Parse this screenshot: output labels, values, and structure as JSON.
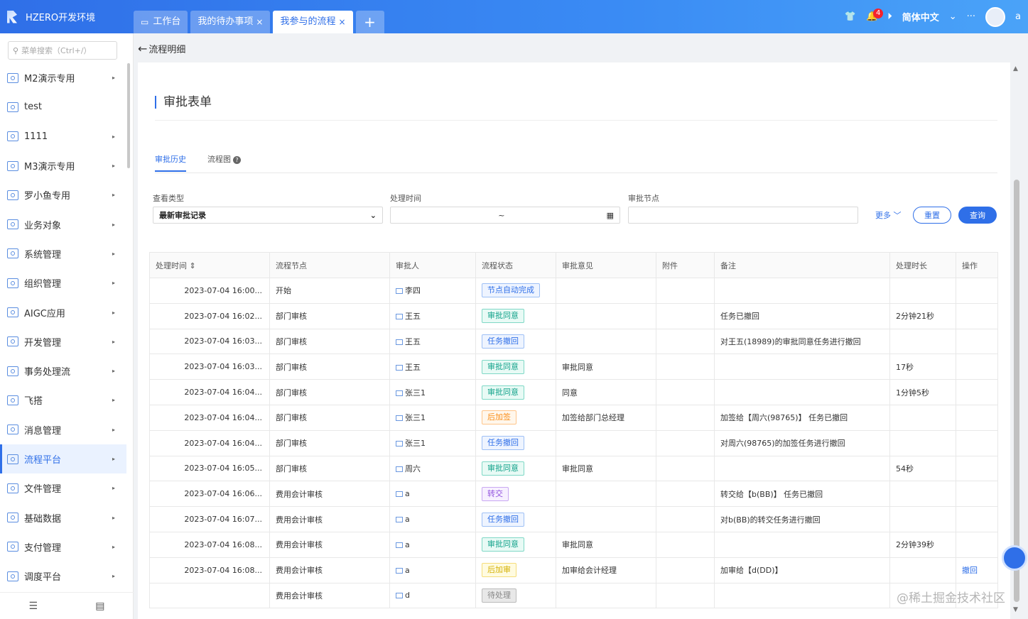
{
  "app": {
    "title": "HZERO开发环境"
  },
  "tabs": [
    {
      "label": "工作台",
      "icon": "monitor-icon"
    },
    {
      "label": "我的待办事项",
      "close": "×"
    },
    {
      "label": "我参与的流程",
      "close": "×"
    }
  ],
  "header": {
    "notifications": "4",
    "language": "简体中文",
    "more": "···",
    "user": "a"
  },
  "sidebar": {
    "search_placeholder": "菜单搜索（Ctrl+/）",
    "items": [
      {
        "label": "M2演示专用"
      },
      {
        "label": "test"
      },
      {
        "label": "1111"
      },
      {
        "label": "M3演示专用"
      },
      {
        "label": "罗小鱼专用"
      },
      {
        "label": "业务对象"
      },
      {
        "label": "系统管理"
      },
      {
        "label": "组织管理"
      },
      {
        "label": "AIGC应用"
      },
      {
        "label": "开发管理"
      },
      {
        "label": "事务处理流"
      },
      {
        "label": "飞搭"
      },
      {
        "label": "消息管理"
      },
      {
        "label": "流程平台"
      },
      {
        "label": "文件管理"
      },
      {
        "label": "基础数据"
      },
      {
        "label": "支付管理"
      },
      {
        "label": "调度平台"
      }
    ]
  },
  "breadcrumb": {
    "back": "←",
    "title": "流程明细"
  },
  "section": {
    "title": "审批表单"
  },
  "subtabs": {
    "history": "审批历史",
    "flowchart": "流程图"
  },
  "filters": {
    "type_label": "查看类型",
    "type_value": "最新审批记录",
    "time_label": "处理时间",
    "time_sep": "~",
    "node_label": "审批节点",
    "more": "更多",
    "reset": "重置",
    "query": "查询"
  },
  "table": {
    "headers": [
      "处理时间",
      "流程节点",
      "审批人",
      "流程状态",
      "审批意见",
      "附件",
      "备注",
      "处理时长",
      "操作"
    ],
    "rows": [
      {
        "time": "2023-07-04 16:00...",
        "node": "开始",
        "user": "李四",
        "status": "节点自动完成",
        "opinion": "",
        "remark": "",
        "duration": "",
        "action": ""
      },
      {
        "time": "2023-07-04 16:02...",
        "node": "部门审核",
        "user": "王五",
        "status": "审批同意",
        "opinion": "",
        "remark": "任务已撤回",
        "duration": "2分钟21秒",
        "action": ""
      },
      {
        "time": "2023-07-04 16:03...",
        "node": "部门审核",
        "user": "王五",
        "status": "任务撤回",
        "opinion": "",
        "remark": "对王五(18989)的审批同意任务进行撤回",
        "duration": "",
        "action": ""
      },
      {
        "time": "2023-07-04 16:03...",
        "node": "部门审核",
        "user": "王五",
        "status": "审批同意",
        "opinion": "审批同意",
        "remark": "",
        "duration": "17秒",
        "action": ""
      },
      {
        "time": "2023-07-04 16:04...",
        "node": "部门审核",
        "user": "张三1",
        "status": "审批同意",
        "opinion": "同意",
        "remark": "",
        "duration": "1分钟5秒",
        "action": ""
      },
      {
        "time": "2023-07-04 16:04...",
        "node": "部门审核",
        "user": "张三1",
        "status": "后加签",
        "opinion": "加签给部门总经理",
        "remark": "加签给【周六(98765)】 任务已撤回",
        "duration": "",
        "action": ""
      },
      {
        "time": "2023-07-04 16:04...",
        "node": "部门审核",
        "user": "张三1",
        "status": "任务撤回",
        "opinion": "",
        "remark": "对周六(98765)的加签任务进行撤回",
        "duration": "",
        "action": ""
      },
      {
        "time": "2023-07-04 16:05...",
        "node": "部门审核",
        "user": "周六",
        "status": "审批同意",
        "opinion": "审批同意",
        "remark": "",
        "duration": "54秒",
        "action": ""
      },
      {
        "time": "2023-07-04 16:06...",
        "node": "费用会计审核",
        "user": "a",
        "status": "转交",
        "opinion": "",
        "remark": "转交给【b(BB)】 任务已撤回",
        "duration": "",
        "action": ""
      },
      {
        "time": "2023-07-04 16:07...",
        "node": "费用会计审核",
        "user": "a",
        "status": "任务撤回",
        "opinion": "",
        "remark": "对b(BB)的转交任务进行撤回",
        "duration": "",
        "action": ""
      },
      {
        "time": "2023-07-04 16:08...",
        "node": "费用会计审核",
        "user": "a",
        "status": "审批同意",
        "opinion": "审批同意",
        "remark": "",
        "duration": "2分钟39秒",
        "action": ""
      },
      {
        "time": "2023-07-04 16:08...",
        "node": "费用会计审核",
        "user": "a",
        "status": "后加审",
        "opinion": "加审给会计经理",
        "remark": "加审给【d(DD)】",
        "duration": "",
        "action": "撤回"
      },
      {
        "time": "",
        "node": "费用会计审核",
        "user": "d",
        "status": "待处理",
        "opinion": "",
        "remark": "",
        "duration": "",
        "action": ""
      }
    ]
  },
  "watermark": "@稀土掘金技术社区",
  "colors": {
    "primary": "#2f6fe8"
  }
}
